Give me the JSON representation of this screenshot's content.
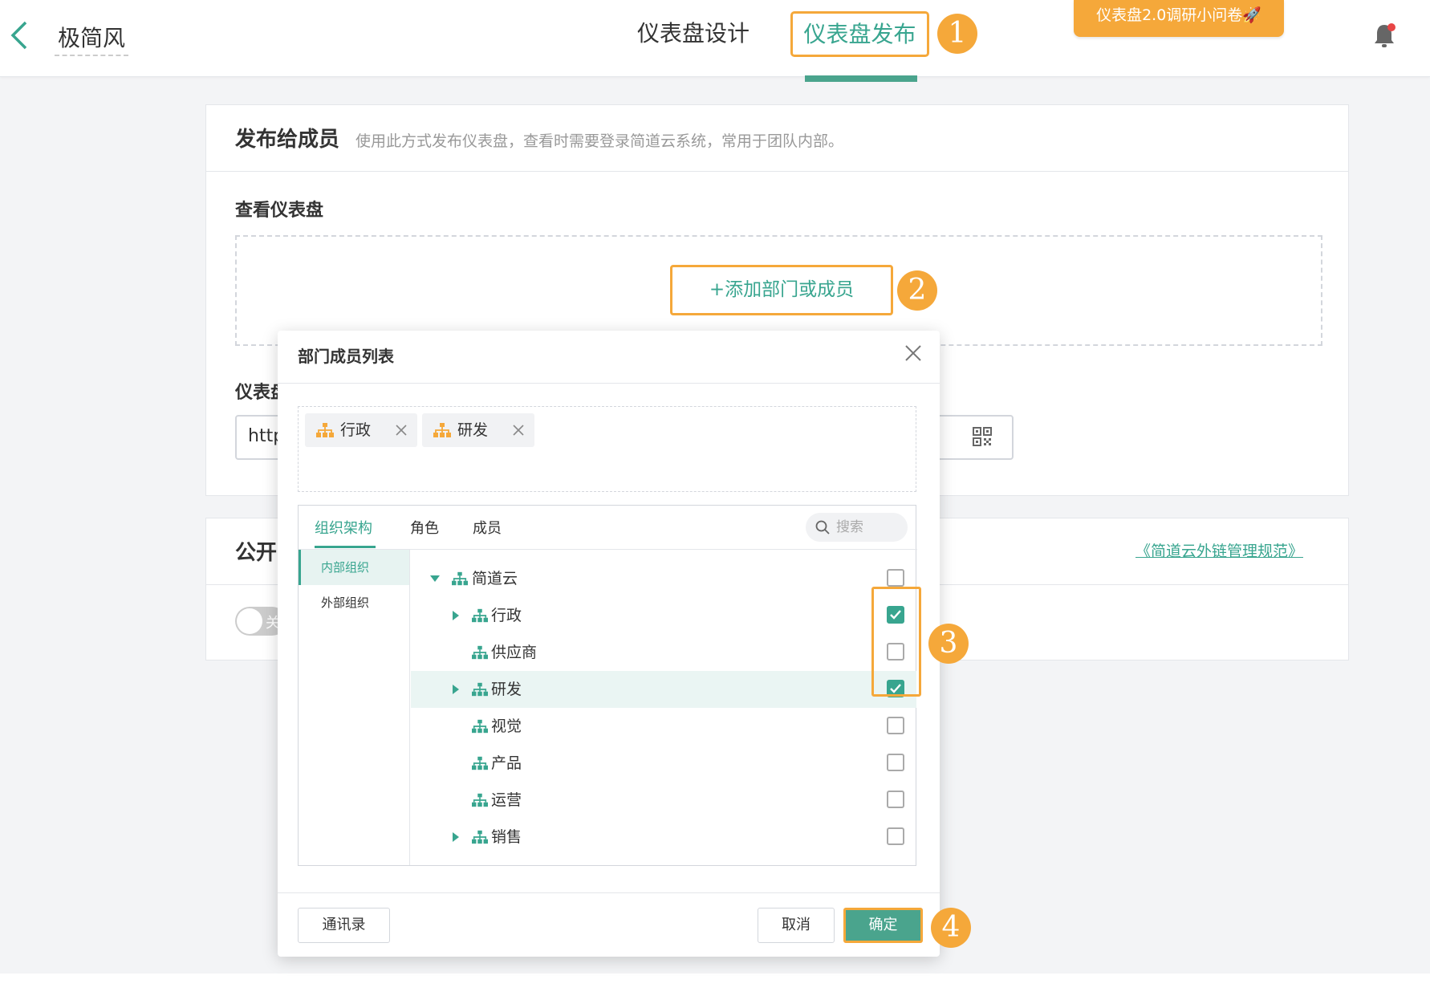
{
  "topbar": {
    "doc_title": "极简风",
    "tab_design": "仪表盘设计",
    "tab_publish": "仪表盘发布",
    "survey": "仪表盘2.0调研小问卷🚀"
  },
  "markers": [
    "1",
    "2",
    "3",
    "4"
  ],
  "publish_members": {
    "title": "发布给成员",
    "desc": "使用此方式发布仪表盘，查看时需要登录简道云系统，常用于团队内部。",
    "view_label": "查看仪表盘",
    "add_button": "+添加部门或成员",
    "link_label": "仪表盘",
    "url_value": "http"
  },
  "public": {
    "title": "公开",
    "link_text": "《简道云外链管理规范》",
    "toggle_text": "关",
    "toggle_on": false
  },
  "modal": {
    "title": "部门成员列表",
    "selected_tags": [
      "行政",
      "研发"
    ],
    "tabs": [
      "组织架构",
      "角色",
      "成员"
    ],
    "search_placeholder": "搜索",
    "side_items": [
      "内部组织",
      "外部组织"
    ],
    "tree": [
      {
        "label": "简道云",
        "expanded": true,
        "has_children": true,
        "checked": false
      },
      {
        "label": "行政",
        "expanded": false,
        "has_children": true,
        "checked": true
      },
      {
        "label": "供应商",
        "has_children": false,
        "checked": false
      },
      {
        "label": "研发",
        "expanded": false,
        "has_children": true,
        "checked": true,
        "highlighted": true
      },
      {
        "label": "视觉",
        "has_children": false,
        "checked": false
      },
      {
        "label": "产品",
        "has_children": false,
        "checked": false
      },
      {
        "label": "运营",
        "has_children": false,
        "checked": false
      },
      {
        "label": "销售",
        "expanded": false,
        "has_children": true,
        "checked": false
      }
    ],
    "btn_contacts": "通讯录",
    "btn_cancel": "取消",
    "btn_ok": "确定"
  },
  "colors": {
    "accent": "#38a58f",
    "highlight": "#f5a83a"
  }
}
